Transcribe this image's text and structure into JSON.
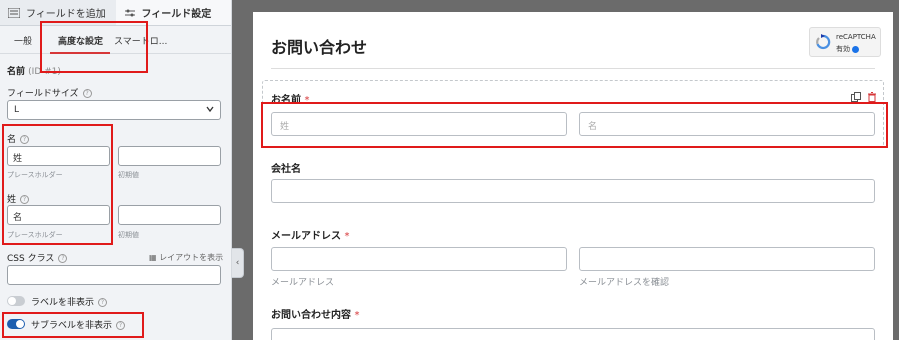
{
  "left_panel": {
    "top_buttons": [
      {
        "label": "フィールドを追加",
        "icon": "list-icon"
      },
      {
        "label": "フィールド設定",
        "icon": "sliders-icon"
      }
    ],
    "tabs": [
      {
        "label": "一般"
      },
      {
        "label": "高度な設定"
      },
      {
        "label": "スマートロ..."
      }
    ],
    "name_label": "名前",
    "name_id": "(ID #1)",
    "field_size_label": "フィールドサイズ",
    "field_size_value": "L",
    "first_label": "名",
    "first_value": "姓",
    "first_sub": "プレースホルダー",
    "first_default_sub": "初期値",
    "last_label": "姓",
    "last_value": "名",
    "last_sub": "プレースホルダー",
    "last_default_sub": "初期値",
    "css_label": "CSS クラス",
    "layout_link": "レイアウトを表示",
    "hide_label_text": "ラベルを非表示",
    "hide_sublabel_text": "サブラベルを非表示"
  },
  "form": {
    "title": "お問い合わせ",
    "recaptcha_title": "reCAPTCHA",
    "recaptcha_status": "有効",
    "fields": {
      "name_label": "お名前",
      "name_required": "*",
      "name_first_placeholder": "姓",
      "name_last_placeholder": "名",
      "company_label": "会社名",
      "email_label": "メールアドレス",
      "email_required": "*",
      "email_sub": "メールアドレス",
      "email_confirm_sub": "メールアドレスを確認",
      "inquiry_label": "お問い合わせ内容",
      "inquiry_required": "*"
    }
  },
  "colors": {
    "accent_red": "#d63638",
    "highlight_red": "#e01a1a",
    "toggle_blue": "#1d5fb0"
  }
}
